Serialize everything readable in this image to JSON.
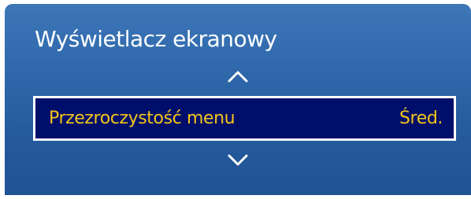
{
  "panel": {
    "title": "Wyświetlacz ekranowy"
  },
  "menu": {
    "scroll_up_icon": "chevron-up-icon",
    "scroll_down_icon": "chevron-down-icon",
    "selected_item": {
      "label": "Przezroczystość menu",
      "value": "Śred."
    }
  },
  "colors": {
    "panel_blue": "#2f68ab",
    "selection_bg": "#000e6b",
    "selection_text": "#f3c519",
    "title_text": "#ffffff"
  }
}
